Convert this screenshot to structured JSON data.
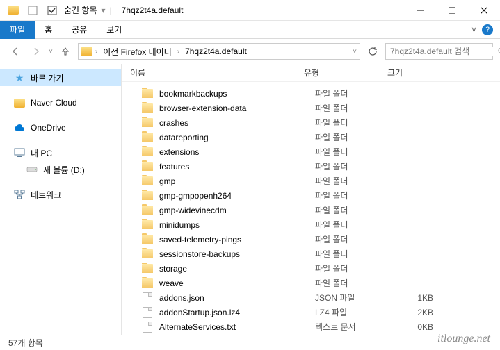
{
  "titlebar": {
    "hidden_items": "숨긴 항목",
    "title": "7hqz2t4a.default"
  },
  "ribbon": {
    "file": "파일",
    "home": "홈",
    "share": "공유",
    "view": "보기"
  },
  "breadcrumb": {
    "item1": "이전 Firefox 데이터",
    "item2": "7hqz2t4a.default"
  },
  "search": {
    "placeholder": "7hqz2t4a.default 검색"
  },
  "sidebar": {
    "quick_access": "바로 가기",
    "naver_cloud": "Naver Cloud",
    "onedrive": "OneDrive",
    "this_pc": "내 PC",
    "volume_d": "새 볼륨 (D:)",
    "network": "네트워크"
  },
  "columns": {
    "name": "이름",
    "type": "유형",
    "size": "크기"
  },
  "items": [
    {
      "name": "bookmarkbackups",
      "type": "파일 폴더",
      "size": "",
      "kind": "folder"
    },
    {
      "name": "browser-extension-data",
      "type": "파일 폴더",
      "size": "",
      "kind": "folder"
    },
    {
      "name": "crashes",
      "type": "파일 폴더",
      "size": "",
      "kind": "folder"
    },
    {
      "name": "datareporting",
      "type": "파일 폴더",
      "size": "",
      "kind": "folder"
    },
    {
      "name": "extensions",
      "type": "파일 폴더",
      "size": "",
      "kind": "folder"
    },
    {
      "name": "features",
      "type": "파일 폴더",
      "size": "",
      "kind": "folder"
    },
    {
      "name": "gmp",
      "type": "파일 폴더",
      "size": "",
      "kind": "folder"
    },
    {
      "name": "gmp-gmpopenh264",
      "type": "파일 폴더",
      "size": "",
      "kind": "folder"
    },
    {
      "name": "gmp-widevinecdm",
      "type": "파일 폴더",
      "size": "",
      "kind": "folder"
    },
    {
      "name": "minidumps",
      "type": "파일 폴더",
      "size": "",
      "kind": "folder"
    },
    {
      "name": "saved-telemetry-pings",
      "type": "파일 폴더",
      "size": "",
      "kind": "folder"
    },
    {
      "name": "sessionstore-backups",
      "type": "파일 폴더",
      "size": "",
      "kind": "folder"
    },
    {
      "name": "storage",
      "type": "파일 폴더",
      "size": "",
      "kind": "folder"
    },
    {
      "name": "weave",
      "type": "파일 폴더",
      "size": "",
      "kind": "folder"
    },
    {
      "name": "addons.json",
      "type": "JSON 파일",
      "size": "1KB",
      "kind": "file"
    },
    {
      "name": "addonStartup.json.lz4",
      "type": "LZ4 파일",
      "size": "2KB",
      "kind": "file"
    },
    {
      "name": "AlternateServices.txt",
      "type": "텍스트 문서",
      "size": "0KB",
      "kind": "file"
    }
  ],
  "statusbar": {
    "count": "57개 항목"
  },
  "watermark": "itlounge.net"
}
